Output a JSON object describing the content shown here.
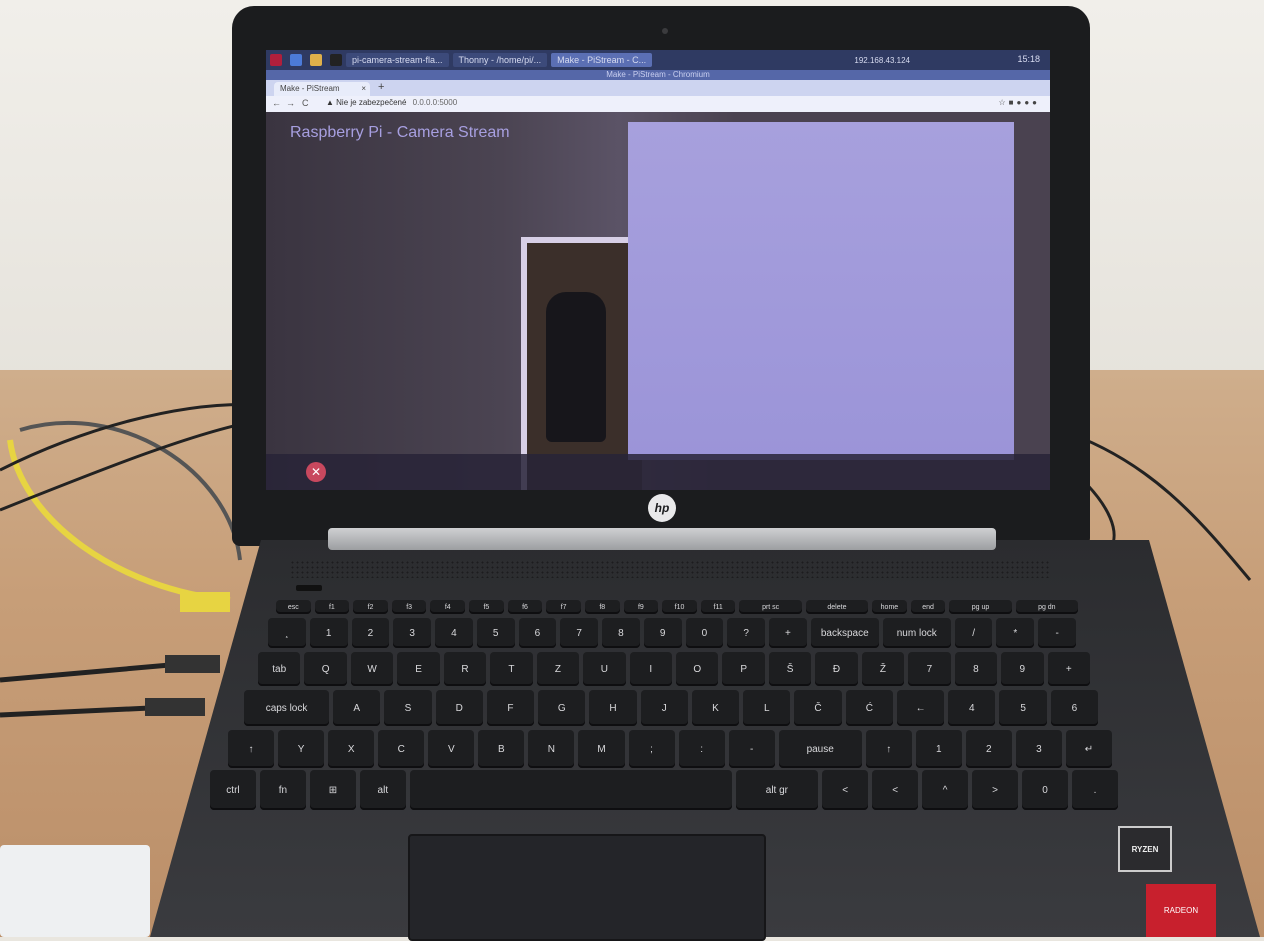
{
  "taskbar": {
    "tasks": [
      "pi-camera-stream-fla...",
      "Thonny - /home/pi/...",
      "Make - PiStream - C..."
    ],
    "ip": "192.168.43.124",
    "clock": "15:18",
    "colors": {
      "bar": "#2f3a62",
      "active": "#5b6fb4"
    }
  },
  "window": {
    "title": "Make - PiStream - Chromium"
  },
  "browser": {
    "tab_label": "Make - PiStream",
    "tab_close": "×",
    "new_tab": "+",
    "nav_back": "←",
    "nav_forward": "→",
    "nav_reload": "C",
    "url_warning": "▲ Nie je zabezpečené",
    "url": "0.0.0.0:5000"
  },
  "page": {
    "title": "Raspberry Pi - Camera Stream",
    "stop_glyph": "✕",
    "colors": {
      "title": "#a79fe0",
      "stop": "#c8485e"
    }
  },
  "laptop": {
    "logo": "hp",
    "sticker_cpu": "RYZEN",
    "sticker_gpu": "RADEON"
  },
  "keyboard": {
    "row0": [
      "esc",
      "f1",
      "f2",
      "f3",
      "f4",
      "f5",
      "f6",
      "f7",
      "f8",
      "f9",
      "f10",
      "f11",
      "prt sc",
      "delete",
      "home",
      "end",
      "pg up",
      "pg dn"
    ],
    "row1": [
      "¸",
      "1",
      "2",
      "3",
      "4",
      "5",
      "6",
      "7",
      "8",
      "9",
      "0",
      "?",
      "+",
      "backspace",
      "num lock",
      "/",
      "*",
      "-"
    ],
    "row2": [
      "tab",
      "Q",
      "W",
      "E",
      "R",
      "T",
      "Z",
      "U",
      "I",
      "O",
      "P",
      "Š",
      "Đ",
      "Ž",
      "7",
      "8",
      "9",
      "+"
    ],
    "row3": [
      "caps lock",
      "A",
      "S",
      "D",
      "F",
      "G",
      "H",
      "J",
      "K",
      "L",
      "Č",
      "Ć",
      "←",
      "4",
      "5",
      "6"
    ],
    "row4": [
      "↑",
      "Y",
      "X",
      "C",
      "V",
      "B",
      "N",
      "M",
      ";",
      ":",
      "-",
      "pause",
      "↑",
      "1",
      "2",
      "3",
      "↵"
    ],
    "row5": [
      "ctrl",
      "fn",
      "⊞",
      "alt",
      "",
      "alt gr",
      "<",
      "<",
      "^",
      ">",
      "0",
      "."
    ]
  }
}
